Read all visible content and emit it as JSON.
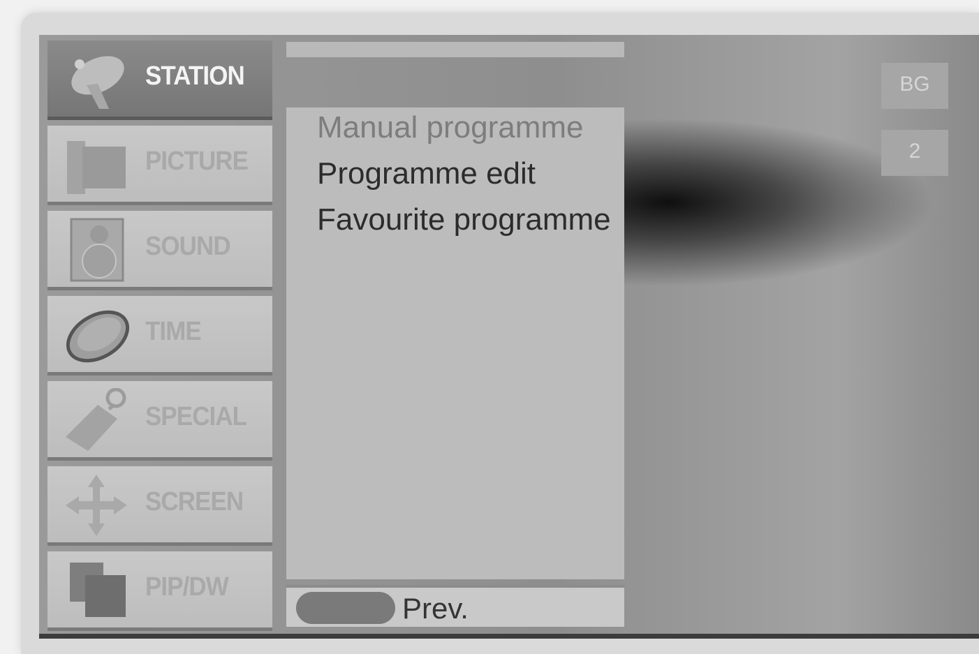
{
  "sidebar": {
    "items": [
      {
        "label": "STATION",
        "icon": "satellite-dish-icon",
        "active": true
      },
      {
        "label": "PICTURE",
        "icon": "picture-icon",
        "active": false
      },
      {
        "label": "SOUND",
        "icon": "speaker-icon",
        "active": false
      },
      {
        "label": "TIME",
        "icon": "clock-icon",
        "active": false
      },
      {
        "label": "SPECIAL",
        "icon": "tag-icon",
        "active": false
      },
      {
        "label": "SCREEN",
        "icon": "move-arrows-icon",
        "active": false
      },
      {
        "label": "PIP/DW",
        "icon": "pip-icon",
        "active": false
      }
    ]
  },
  "menu": {
    "items": [
      {
        "label": "Manual programme",
        "state": "dimmed"
      },
      {
        "label": "Programme edit",
        "state": "normal"
      },
      {
        "label": "Favourite programme",
        "state": "normal"
      }
    ]
  },
  "footer": {
    "prev_label": "Prev."
  },
  "status": {
    "system": "BG",
    "channel": "2"
  }
}
